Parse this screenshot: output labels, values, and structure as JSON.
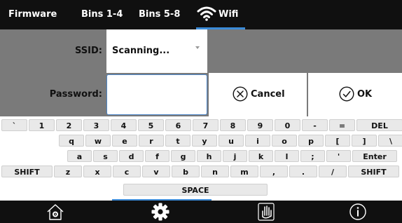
{
  "tabs": [
    {
      "label": "Firmware"
    },
    {
      "label": "Bins 1-4"
    },
    {
      "label": "Bins 5-8"
    },
    {
      "label": "Wifi",
      "icon": "wifi-icon",
      "active": true
    }
  ],
  "form": {
    "ssid_label": "SSID:",
    "ssid_value": "Scanning...",
    "password_label": "Password:",
    "password_value": ""
  },
  "buttons": {
    "cancel_label": "Cancel",
    "cancel_icon": "circle-x-icon",
    "ok_label": "OK",
    "ok_icon": "circle-check-icon"
  },
  "keyboard": {
    "rows": [
      [
        "`",
        "1",
        "2",
        "3",
        "4",
        "5",
        "6",
        "7",
        "8",
        "9",
        "0",
        "-",
        "=",
        "DEL"
      ],
      [
        "q",
        "w",
        "e",
        "r",
        "t",
        "y",
        "u",
        "i",
        "o",
        "p",
        "[",
        "]",
        "\\"
      ],
      [
        "a",
        "s",
        "d",
        "f",
        "g",
        "h",
        "j",
        "k",
        "l",
        ";",
        "'",
        "Enter"
      ],
      [
        "SHIFT",
        "z",
        "x",
        "c",
        "v",
        "b",
        "n",
        "m",
        ",",
        ".",
        "/",
        "SHIFT"
      ],
      [
        "SPACE"
      ]
    ]
  },
  "bottom_nav": [
    {
      "icon": "home-icon"
    },
    {
      "icon": "gear-icon",
      "active": true
    },
    {
      "icon": "hand-icon"
    },
    {
      "icon": "info-icon"
    }
  ],
  "colors": {
    "bar_background": "#101010",
    "field_background": "#7a7a7a",
    "accent": "#3b8bd8",
    "key_background": "#e9e9e9"
  }
}
